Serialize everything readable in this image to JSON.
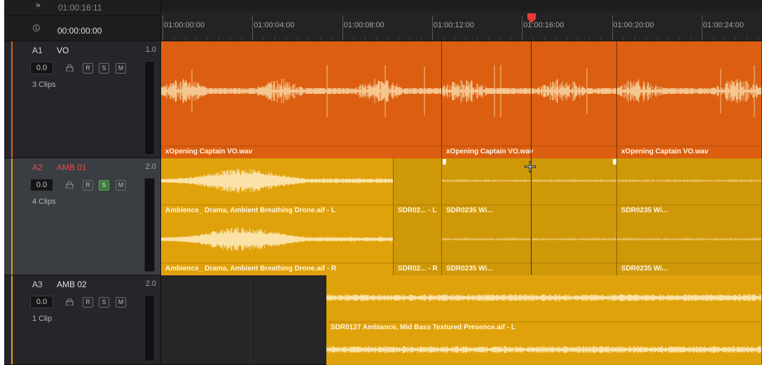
{
  "header": {
    "flag_glyph": "⚑",
    "top_timecode": "01:00:16:11",
    "current_timecode": "00:00:00:00",
    "clock_icon": "clock-icon"
  },
  "ruler": {
    "labels": [
      "01:00:00:00",
      "01:00:04:00",
      "01:00:08:00",
      "01:00:12:00",
      "01:00:16:00",
      "01:00:20:00",
      "01:00:24:00"
    ]
  },
  "colors": {
    "playhead": "#e83a3a",
    "vo_clip": "#dc5e10",
    "amb_clip": "#e0a20a",
    "a1_accent": "#dc5e10",
    "a2_accent": "#e0a20a",
    "a3_accent": "#e0a20a"
  },
  "tracks": [
    {
      "id": "A1",
      "name": "VO",
      "channels": "1.0",
      "volume": "0.0",
      "buttons": [
        "R",
        "S",
        "M"
      ],
      "clip_count": "3 Clips",
      "solo_on": false,
      "selected": false
    },
    {
      "id": "A2",
      "name": "AMB 01",
      "channels": "2.0",
      "volume": "0.0",
      "buttons": [
        "R",
        "S",
        "M"
      ],
      "clip_count": "4 Clips",
      "solo_on": true,
      "selected": true
    },
    {
      "id": "A3",
      "name": "AMB 02",
      "channels": "2.0",
      "volume": "0.0",
      "buttons": [
        "R",
        "S",
        "M"
      ],
      "clip_count": "1 Clip",
      "solo_on": false,
      "selected": false
    }
  ],
  "clips": {
    "vo1": "xOpening Captain VO.wav",
    "vo2": "xOpening Captain VO.wav",
    "vo3": "xOpening Captain VO.wav",
    "a2_l1": "Ambience_ Drama, Ambient Breathing Drone.aif - L",
    "a2_l2": "SDR02... - L",
    "a2_l3": "SDR0235 Wi...",
    "a2_l4": "SDR0235 Wi...",
    "a2_r1": "Ambience_ Drama, Ambient Breathing Drone.aif - R",
    "a2_r2": "SDR02... - R",
    "a2_r3": "SDR0235 Wi...",
    "a2_r4": "SDR0235 Wi...",
    "a3_l": "SDR0127 Ambiance, Mid Bass Textured Presence.aif - L"
  }
}
